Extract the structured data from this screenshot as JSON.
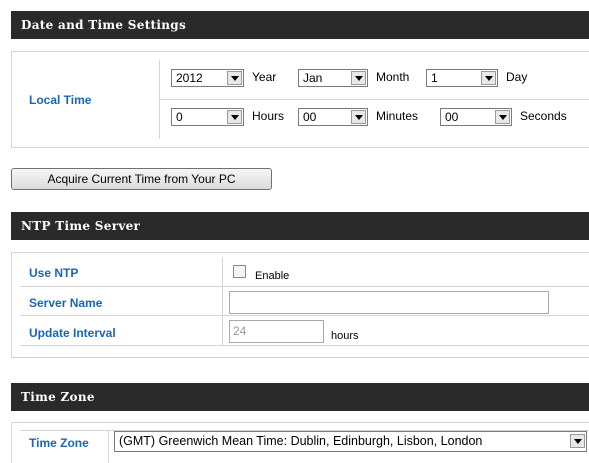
{
  "date_time": {
    "title": "Date and Time Settings",
    "local_time_label": "Local Time",
    "year": {
      "value": "2012",
      "unit": "Year"
    },
    "month": {
      "value": "Jan",
      "unit": "Month"
    },
    "day": {
      "value": "1",
      "unit": "Day"
    },
    "hours": {
      "value": "0",
      "unit": "Hours"
    },
    "minutes": {
      "value": "00",
      "unit": "Minutes"
    },
    "seconds": {
      "value": "00",
      "unit": "Seconds"
    }
  },
  "acquire_button": "Acquire Current Time from Your PC",
  "ntp": {
    "title": "NTP Time Server",
    "use_ntp_label": "Use NTP",
    "enable_label": "Enable",
    "enable_checked": false,
    "server_name_label": "Server Name",
    "server_name_value": "",
    "update_interval_label": "Update Interval",
    "update_interval_value": "24",
    "update_interval_unit": "hours"
  },
  "timezone": {
    "title": "Time Zone",
    "label": "Time Zone",
    "value": "(GMT) Greenwich Mean Time: Dublin, Edinburgh, Lisbon, London"
  },
  "colors": {
    "header_bg": "#2a2a2a",
    "label_blue": "#1a66b3"
  }
}
